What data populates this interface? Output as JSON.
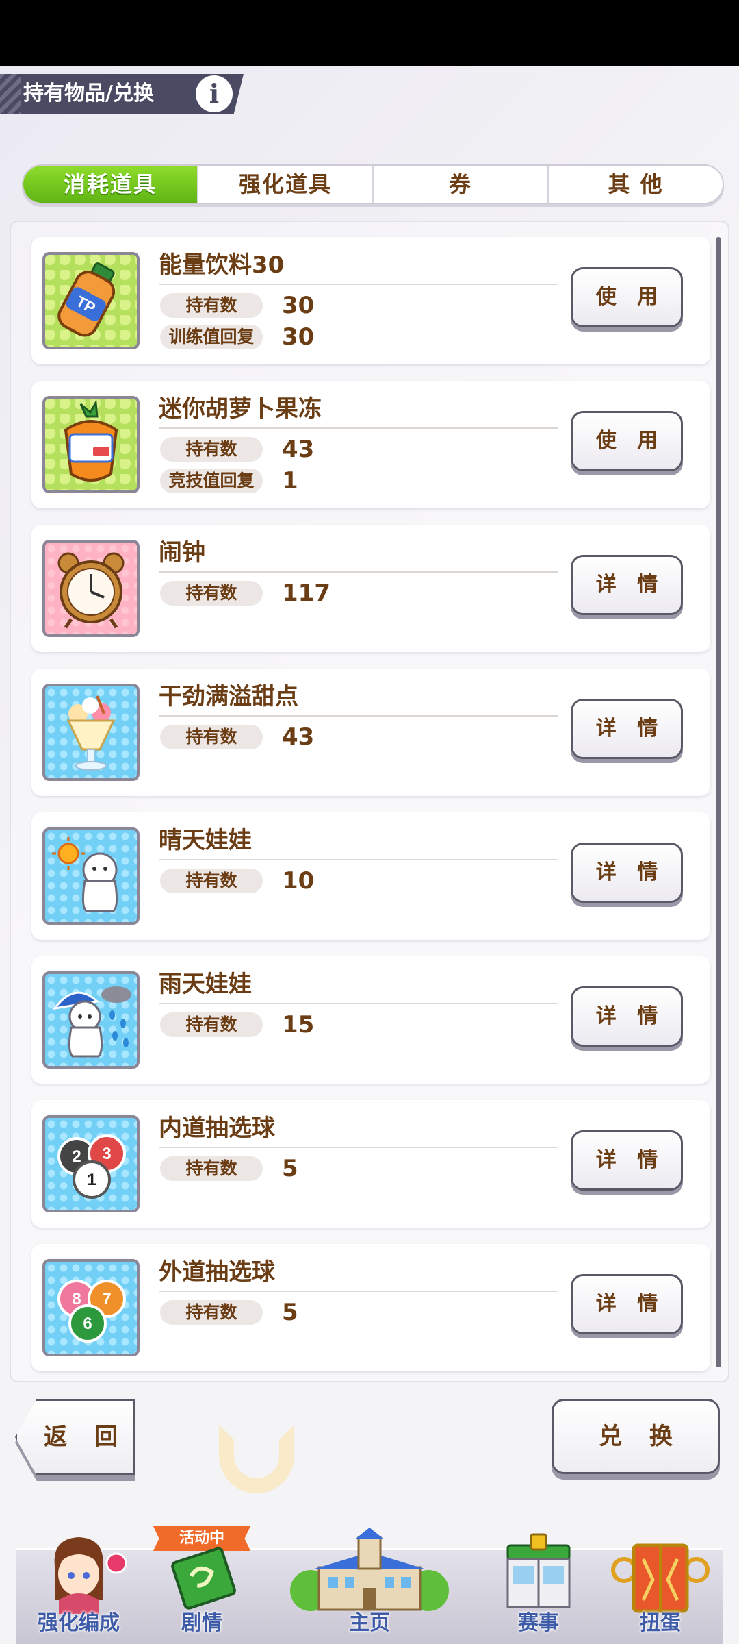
{
  "header": {
    "title": "持有物品/兑换",
    "info_symbol": "i"
  },
  "tabs": [
    {
      "label": "消耗道具",
      "active": true
    },
    {
      "label": "强化道具",
      "active": false
    },
    {
      "label": "券",
      "active": false
    },
    {
      "label": "其 他",
      "active": false
    }
  ],
  "items": [
    {
      "name": "能量饮料30",
      "icon": "energy-drink-icon",
      "stats": [
        {
          "label": "持有数",
          "value": "30"
        },
        {
          "label": "训练值回复",
          "value": "30"
        }
      ],
      "button": "使 用"
    },
    {
      "name": "迷你胡萝卜果冻",
      "icon": "carrot-jelly-icon",
      "stats": [
        {
          "label": "持有数",
          "value": "43"
        },
        {
          "label": "竞技值回复",
          "value": "1"
        }
      ],
      "button": "使 用"
    },
    {
      "name": "闹钟",
      "icon": "alarm-clock-icon",
      "stats": [
        {
          "label": "持有数",
          "value": "117"
        }
      ],
      "button": "详 情"
    },
    {
      "name": "干劲满溢甜点",
      "icon": "parfait-icon",
      "stats": [
        {
          "label": "持有数",
          "value": "43"
        }
      ],
      "button": "详 情"
    },
    {
      "name": "晴天娃娃",
      "icon": "sunny-doll-icon",
      "stats": [
        {
          "label": "持有数",
          "value": "10"
        }
      ],
      "button": "详 情"
    },
    {
      "name": "雨天娃娃",
      "icon": "rainy-doll-icon",
      "stats": [
        {
          "label": "持有数",
          "value": "15"
        }
      ],
      "button": "详 情"
    },
    {
      "name": "内道抽选球",
      "icon": "inner-lottery-balls-icon",
      "stats": [
        {
          "label": "持有数",
          "value": "5"
        }
      ],
      "button": "详 情"
    },
    {
      "name": "外道抽选球",
      "icon": "outer-lottery-balls-icon",
      "stats": [
        {
          "label": "持有数",
          "value": "5"
        }
      ],
      "button": "详 情"
    }
  ],
  "icon_text": {
    "energy_drink": "TP",
    "inner_balls": [
      "2",
      "3",
      "1"
    ],
    "outer_balls": [
      "8",
      "7",
      "6"
    ]
  },
  "footer": {
    "back_label": "返 回",
    "exchange_label": "兑 换"
  },
  "bottom_nav": {
    "event_badge": "活动中",
    "items": [
      {
        "label": "强化编成",
        "icon": "character-icon"
      },
      {
        "label": "剧情",
        "icon": "story-book-icon"
      },
      {
        "label": "主页",
        "icon": "school-building-icon"
      },
      {
        "label": "赛事",
        "icon": "race-gate-icon"
      },
      {
        "label": "扭蛋",
        "icon": "gacha-door-icon"
      }
    ]
  },
  "colors": {
    "active_tab": "#6cc41c",
    "text_brown": "#6b3d14",
    "nav_label": "#3e5ba8",
    "event_badge": "#f06b2a"
  }
}
